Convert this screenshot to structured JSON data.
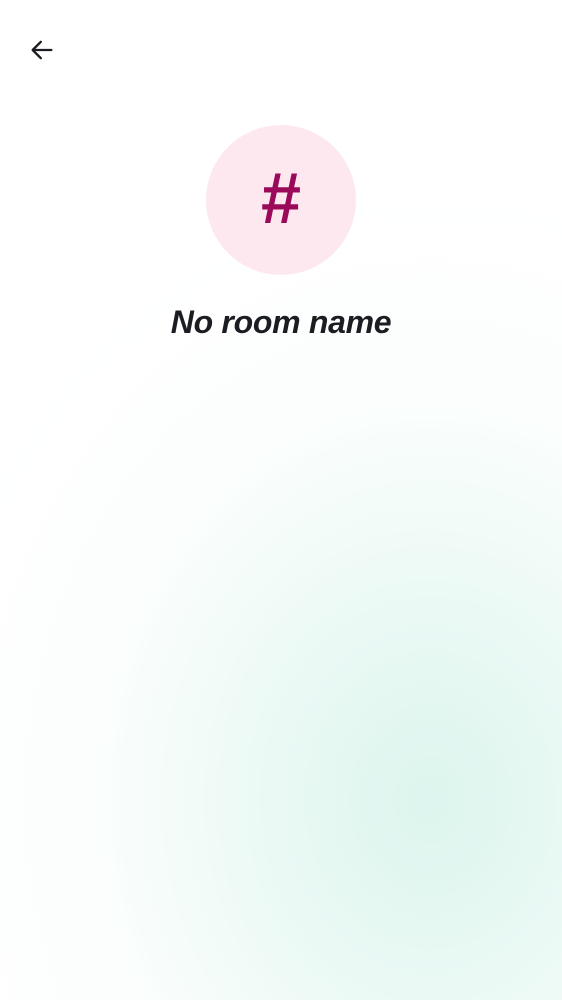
{
  "header": {
    "back_icon": "arrow-left-icon"
  },
  "room": {
    "avatar_glyph": "#",
    "avatar_icon": "hash-icon",
    "name_placeholder": "No room name"
  },
  "colors": {
    "avatar_background": "#fde8ef",
    "avatar_glyph": "#9b0a5a",
    "text_primary": "#1b1d22",
    "background_tint": "#dff5ee"
  }
}
